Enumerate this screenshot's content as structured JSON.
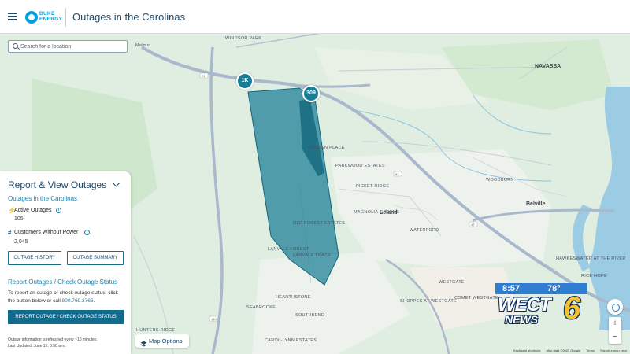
{
  "header": {
    "logo_text": "DUKE ENERGY.",
    "title": "Outages in the Carolinas"
  },
  "search": {
    "placeholder": "Search for a location"
  },
  "panel": {
    "title": "Report & View Outages",
    "subtitle": "Outages in the Carolinas",
    "active_outages_label": "Active Outages",
    "active_outages_value": "105",
    "customers_label": "Customers Without Power",
    "customers_value": "2,045",
    "history_button": "OUTAGE HISTORY",
    "summary_button": "OUTAGE SUMMARY",
    "report_title": "Report Outages / Check Outage Status",
    "report_text": "To report an outage or check outage status, click the button below or call",
    "phone": "800.769.3766",
    "report_button": "REPORT OUTAGE / CHECK OUTAGE STATUS",
    "footnote_1": "Outage information is refreshed every ~10 minutes.",
    "footnote_2": "Last Updated: June 15, 8:50 a.m."
  },
  "map": {
    "options_label": "Map Options",
    "clusters": [
      {
        "label": "1K"
      },
      {
        "label": "309"
      }
    ],
    "place_labels": [
      "WINDSOR PARK",
      "Malmo",
      "NAVASSA",
      "GARDEN PLACE",
      "PARKWOOD ESTATES",
      "PICKET RIDGE",
      "MAGNOLIA GREENS",
      "Leland",
      "WATERFORD",
      "OLD FOREST ESTATES",
      "LANVALE FOREST",
      "LANVALE TRACE",
      "WOODBURN",
      "Belville",
      "HAWKESWATER AT THE RIVER",
      "RICE HOPE",
      "WESTGATE",
      "COMET WESTGATE",
      "SHOPPES AT WESTGATE",
      "HEARTHSTONE",
      "SEABROOKE",
      "SOUTHBEND",
      "HUNTERS RIDGE",
      "CAROL-LYNN ESTATES"
    ],
    "attribution": [
      "Keyboard shortcuts",
      "Map data ©2025 Google",
      "Terms",
      "Report a map error"
    ],
    "colors": {
      "outage_fill": "#1a7d95",
      "land": "#dfeee1",
      "water": "#9ccbe4",
      "highway": "#a9b8cc"
    }
  },
  "overlay": {
    "time": "8:57",
    "temperature": "78°",
    "station": "WECT",
    "news": "NEWS",
    "channel": "6"
  }
}
